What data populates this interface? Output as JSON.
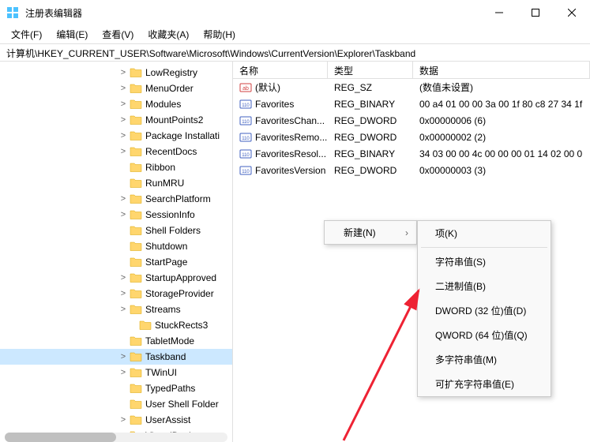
{
  "window": {
    "title": "注册表编辑器"
  },
  "menu": {
    "file": "文件(F)",
    "edit": "编辑(E)",
    "view": "查看(V)",
    "favorites": "收藏夹(A)",
    "help": "帮助(H)"
  },
  "address": "计算机\\HKEY_CURRENT_USER\\Software\\Microsoft\\Windows\\CurrentVersion\\Explorer\\Taskband",
  "tree": [
    {
      "label": "LowRegistry",
      "indent": 148,
      "expand": ">"
    },
    {
      "label": "MenuOrder",
      "indent": 148,
      "expand": ">"
    },
    {
      "label": "Modules",
      "indent": 148,
      "expand": ">"
    },
    {
      "label": "MountPoints2",
      "indent": 148,
      "expand": ">"
    },
    {
      "label": "Package Installati",
      "indent": 148,
      "expand": ">"
    },
    {
      "label": "RecentDocs",
      "indent": 148,
      "expand": ">"
    },
    {
      "label": "Ribbon",
      "indent": 148,
      "expand": ""
    },
    {
      "label": "RunMRU",
      "indent": 148,
      "expand": ""
    },
    {
      "label": "SearchPlatform",
      "indent": 148,
      "expand": ">"
    },
    {
      "label": "SessionInfo",
      "indent": 148,
      "expand": ">"
    },
    {
      "label": "Shell Folders",
      "indent": 148,
      "expand": ""
    },
    {
      "label": "Shutdown",
      "indent": 148,
      "expand": ""
    },
    {
      "label": "StartPage",
      "indent": 148,
      "expand": ""
    },
    {
      "label": "StartupApproved",
      "indent": 148,
      "expand": ">"
    },
    {
      "label": "StorageProvider",
      "indent": 148,
      "expand": ">"
    },
    {
      "label": "Streams",
      "indent": 148,
      "expand": ">"
    },
    {
      "label": "StuckRects3",
      "indent": 160,
      "expand": ""
    },
    {
      "label": "TabletMode",
      "indent": 148,
      "expand": ""
    },
    {
      "label": "Taskband",
      "indent": 148,
      "expand": ">",
      "selected": true
    },
    {
      "label": "TWinUI",
      "indent": 148,
      "expand": ">"
    },
    {
      "label": "TypedPaths",
      "indent": 148,
      "expand": ""
    },
    {
      "label": "User Shell Folder",
      "indent": 148,
      "expand": ""
    },
    {
      "label": "UserAssist",
      "indent": 148,
      "expand": ">"
    },
    {
      "label": "VirtualDesktops",
      "indent": 148,
      "expand": ">"
    }
  ],
  "columns": {
    "name": "名称",
    "type": "类型",
    "data": "数据"
  },
  "values": [
    {
      "icon": "str",
      "name": "(默认)",
      "type": "REG_SZ",
      "data": "(数值未设置)"
    },
    {
      "icon": "bin",
      "name": "Favorites",
      "type": "REG_BINARY",
      "data": "00 a4 01 00 00 3a 00 1f 80 c8 27 34 1f"
    },
    {
      "icon": "bin",
      "name": "FavoritesChan...",
      "type": "REG_DWORD",
      "data": "0x00000006 (6)"
    },
    {
      "icon": "bin",
      "name": "FavoritesRemo...",
      "type": "REG_DWORD",
      "data": "0x00000002 (2)"
    },
    {
      "icon": "bin",
      "name": "FavoritesResol...",
      "type": "REG_BINARY",
      "data": "34 03 00 00 4c 00 00 00 01 14 02 00 0"
    },
    {
      "icon": "bin",
      "name": "FavoritesVersion",
      "type": "REG_DWORD",
      "data": "0x00000003 (3)"
    }
  ],
  "context": {
    "new": "新建(N)",
    "submenu": {
      "key": "项(K)",
      "string": "字符串值(S)",
      "binary": "二进制值(B)",
      "dword": "DWORD (32 位)值(D)",
      "qword": "QWORD (64 位)值(Q)",
      "multi": "多字符串值(M)",
      "expand": "可扩充字符串值(E)"
    }
  }
}
